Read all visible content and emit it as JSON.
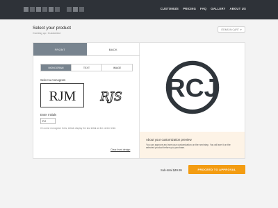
{
  "header": {
    "nav": [
      "CUSTOMIZE",
      "PRICING",
      "FAQ",
      "GALLERY",
      "ABOUT US"
    ]
  },
  "page": {
    "title": "Select your product",
    "subtitle": "Coming up: Customize",
    "items_in_cart": "ITEMS IN CART"
  },
  "tabs": [
    "FRONT",
    "BACK"
  ],
  "style_options": [
    "MONOGRAM",
    "TEXT",
    "IMAGE"
  ],
  "monogram": {
    "select_label": "Select a monogram",
    "option1_text": "RJM",
    "option2_text": "RJS"
  },
  "initials": {
    "label": "Enter Initials",
    "value": "RJ",
    "hint": "On some monogram fonts, initials display the last initial as the center letter.",
    "clear_label": "Clear front design"
  },
  "preview": {
    "monogram_text": "RCJ",
    "note_title": "About your customization preview",
    "note_body": "You can approve and see your customization on the next step. You will see it on the selected product before you purchase."
  },
  "footer": {
    "subtotal": "Sub-total  $49.99",
    "proceed_label": "PROCEED TO APPROVAL"
  },
  "colors": {
    "topbar": "#2e3238",
    "accent": "#f39c12",
    "active_tab": "#78848f",
    "note_bg": "#fdf3e6"
  }
}
